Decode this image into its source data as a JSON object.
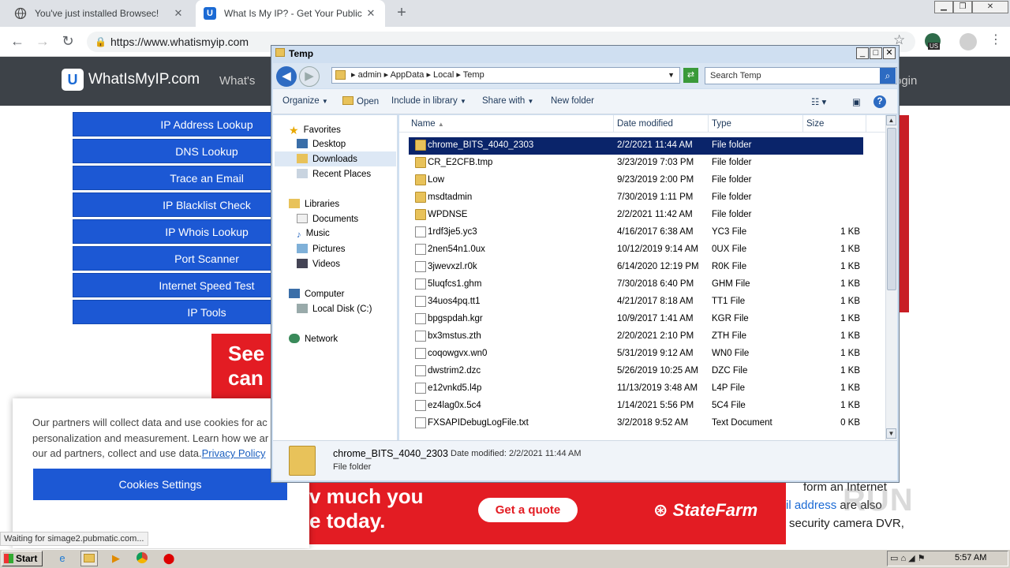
{
  "browser": {
    "tabs": [
      {
        "title": "You've just installed Browsec!",
        "active": false
      },
      {
        "title": "What Is My IP? - Get Your Public IP",
        "active": true
      }
    ],
    "new_tab_symbol": "+",
    "url": "https://www.whatismyip.com",
    "profile_badge": "US",
    "status_text": "Waiting for simage2.pubmatic.com..."
  },
  "site": {
    "logo_text": "WhatIsMyIP.com",
    "nav_partial": "What's",
    "login_partial": "ogin",
    "sidebar": [
      "IP Address Lookup",
      "DNS Lookup",
      "Trace an Email",
      "IP Blacklist Check",
      "IP Whois Lookup",
      "Port Scanner",
      "Internet Speed Test",
      "IP Tools"
    ],
    "ad_top_line1": "See",
    "ad_top_line2": "can",
    "ad_bottom_line1": "v much you",
    "ad_bottom_line2": "e today.",
    "ad_cta": "Get a quote",
    "ad_brand": "StateFarm",
    "right_copy_line1": "form an Internet",
    "right_copy_link": "il address",
    "right_copy_line2_rest": " are also",
    "right_copy_line3": "security camera DVR,",
    "cookie": {
      "line1": "Our partners will collect data and use cookies for ac",
      "line2": "personalization and measurement. Learn how we ar",
      "line3_prefix": "our ad partners, collect and use data.",
      "privacy_link": "Privacy Policy",
      "button": "Cookies Settings"
    }
  },
  "explorer": {
    "title": "Temp",
    "breadcrumb": [
      "admin",
      "AppData",
      "Local",
      "Temp"
    ],
    "search_placeholder": "Search Temp",
    "commands": [
      "Organize",
      "Open",
      "Include in library",
      "Share with",
      "New folder"
    ],
    "nav": {
      "favorites": "Favorites",
      "desktop": "Desktop",
      "downloads": "Downloads",
      "recent": "Recent Places",
      "libraries": "Libraries",
      "documents": "Documents",
      "music": "Music",
      "pictures": "Pictures",
      "videos": "Videos",
      "computer": "Computer",
      "local_disk": "Local Disk (C:)",
      "network": "Network"
    },
    "columns": [
      "Name",
      "Date modified",
      "Type",
      "Size"
    ],
    "files": [
      {
        "name": "chrome_BITS_4040_2303",
        "date": "2/2/2021 11:44 AM",
        "type": "File folder",
        "size": "",
        "folder": true,
        "selected": true
      },
      {
        "name": "CR_E2CFB.tmp",
        "date": "3/23/2019 7:03 PM",
        "type": "File folder",
        "size": "",
        "folder": true
      },
      {
        "name": "Low",
        "date": "9/23/2019 2:00 PM",
        "type": "File folder",
        "size": "",
        "folder": true
      },
      {
        "name": "msdtadmin",
        "date": "7/30/2019 1:11 PM",
        "type": "File folder",
        "size": "",
        "folder": true
      },
      {
        "name": "WPDNSE",
        "date": "2/2/2021 11:42 AM",
        "type": "File folder",
        "size": "",
        "folder": true
      },
      {
        "name": "1rdf3je5.yc3",
        "date": "4/16/2017 6:38 AM",
        "type": "YC3 File",
        "size": "1 KB"
      },
      {
        "name": "2nen54n1.0ux",
        "date": "10/12/2019 9:14 AM",
        "type": "0UX File",
        "size": "1 KB"
      },
      {
        "name": "3jwevxzl.r0k",
        "date": "6/14/2020 12:19 PM",
        "type": "R0K File",
        "size": "1 KB"
      },
      {
        "name": "5luqfcs1.ghm",
        "date": "7/30/2018 6:40 PM",
        "type": "GHM File",
        "size": "1 KB"
      },
      {
        "name": "34uos4pq.tt1",
        "date": "4/21/2017 8:18 AM",
        "type": "TT1 File",
        "size": "1 KB"
      },
      {
        "name": "bpgspdah.kgr",
        "date": "10/9/2017 1:41 AM",
        "type": "KGR File",
        "size": "1 KB"
      },
      {
        "name": "bx3mstus.zth",
        "date": "2/20/2021 2:10 PM",
        "type": "ZTH File",
        "size": "1 KB"
      },
      {
        "name": "coqowgvx.wn0",
        "date": "5/31/2019 9:12 AM",
        "type": "WN0 File",
        "size": "1 KB"
      },
      {
        "name": "dwstrim2.dzc",
        "date": "5/26/2019 10:25 AM",
        "type": "DZC File",
        "size": "1 KB"
      },
      {
        "name": "e12vnkd5.l4p",
        "date": "11/13/2019 3:48 AM",
        "type": "L4P File",
        "size": "1 KB"
      },
      {
        "name": "ez4lag0x.5c4",
        "date": "1/14/2021 5:56 PM",
        "type": "5C4 File",
        "size": "1 KB"
      },
      {
        "name": "FXSAPIDebugLogFile.txt",
        "date": "3/2/2018 9:52 AM",
        "type": "Text Document",
        "size": "0 KB"
      }
    ],
    "details": {
      "name": "chrome_BITS_4040_2303",
      "modified_label": "Date modified: 2/2/2021 11:44 AM",
      "type": "File folder"
    }
  },
  "taskbar": {
    "start": "Start",
    "clock": "5:57 AM"
  },
  "watermark": "RUN",
  "colors": {
    "site_blue": "#1c58d4",
    "ad_red": "#e31c23",
    "selection": "#0a246a"
  }
}
